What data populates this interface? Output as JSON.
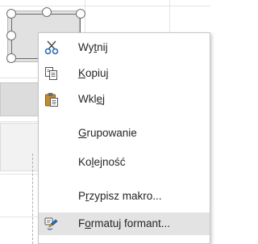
{
  "colors": {
    "menu_background": "#ffffff",
    "menu_border": "#c6c6c6",
    "highlight": "#e3e3e3",
    "text": "#262626",
    "scissors_blue": "#2c6db5",
    "paste_brown": "#c48a2c"
  },
  "context_menu": {
    "items": [
      {
        "id": "cut",
        "pre": "Wy",
        "acc": "t",
        "post": "nij",
        "icon": "scissors-icon",
        "highlighted": false
      },
      {
        "id": "copy",
        "pre": "",
        "acc": "K",
        "post": "opiuj",
        "icon": "copy-icon",
        "highlighted": false
      },
      {
        "id": "paste",
        "pre": "Wkl",
        "acc": "e",
        "post": "j",
        "icon": "paste-icon",
        "highlighted": false
      },
      {
        "id": "group",
        "pre": "",
        "acc": "G",
        "post": "rupowanie",
        "icon": "",
        "highlighted": false
      },
      {
        "id": "order",
        "pre": "Ko",
        "acc": "l",
        "post": "ejność",
        "icon": "",
        "highlighted": false
      },
      {
        "id": "assign-macro",
        "pre": "P",
        "acc": "r",
        "post": "zypisz makro...",
        "icon": "",
        "highlighted": false
      },
      {
        "id": "format-control",
        "pre": "F",
        "acc": "o",
        "post": "rmatuj formant...",
        "icon": "format-control-icon",
        "highlighted": true
      }
    ]
  }
}
